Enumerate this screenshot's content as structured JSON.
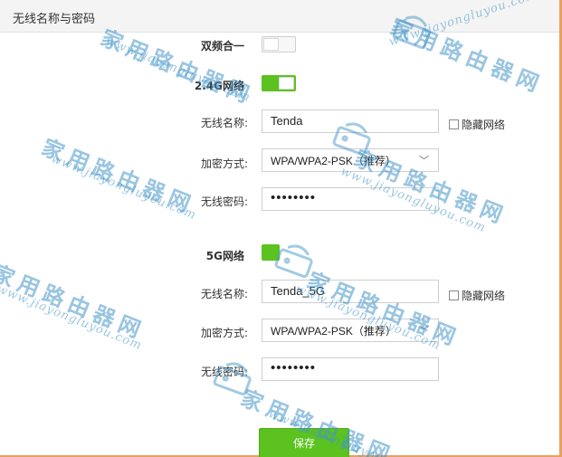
{
  "header": {
    "title": "无线名称与密码"
  },
  "dual_band": {
    "label": "双频合一",
    "enabled": false
  },
  "band_24g": {
    "section_label": "2.4G网络",
    "enabled": true,
    "ssid_label": "无线名称:",
    "ssid_value": "Tenda",
    "hide_label": "隐藏网络",
    "hidden": false,
    "security_label": "加密方式:",
    "security_value": "WPA/WPA2-PSK（推荐）",
    "password_label": "无线密码:",
    "password_value": "••••••••"
  },
  "band_5g": {
    "section_label": "5G网络",
    "enabled": true,
    "ssid_label": "无线名称:",
    "ssid_value": "Tenda_5G",
    "hide_label": "隐藏网络",
    "hidden": false,
    "security_label": "加密方式:",
    "security_value": "WPA/WPA2-PSK（推荐）",
    "password_label": "无线密码:",
    "password_value": "••••••••"
  },
  "actions": {
    "save_label": "保存"
  },
  "watermark": {
    "cn_text": "家用路由器网",
    "url_text": "www.jiayongluyou.com"
  },
  "colors": {
    "accent_green": "#5bc21f",
    "watermark_blue": "#4696c8",
    "frame_orange": "#e8a060"
  },
  "icons": {
    "select_chevron": "chevron-down-icon",
    "watermark_logo": "router-logo-icon"
  }
}
